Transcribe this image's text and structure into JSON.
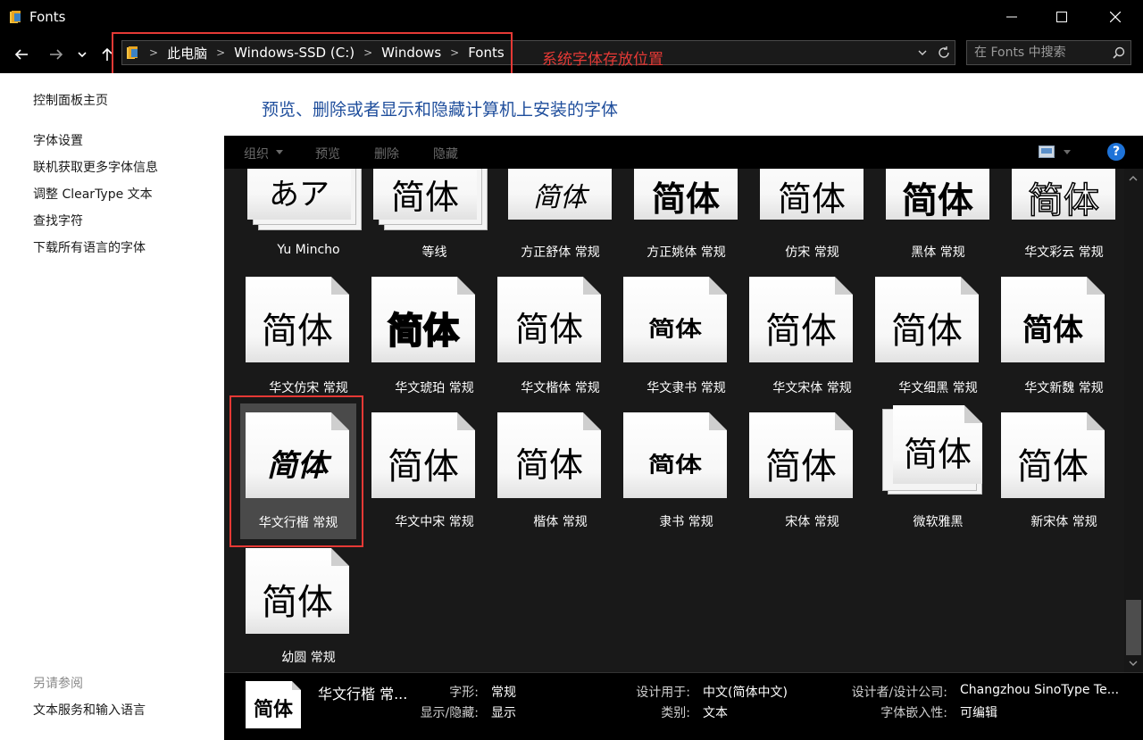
{
  "window": {
    "title": "Fonts"
  },
  "nav": {
    "breadcrumbs": [
      "此电脑",
      "Windows-SSD (C:)",
      "Windows",
      "Fonts"
    ],
    "search_placeholder": "在 Fonts 中搜索",
    "annotation": "系统字体存放位置"
  },
  "sidebar": {
    "links": [
      "控制面板主页",
      "字体设置",
      "联机获取更多字体信息",
      "调整 ClearType 文本",
      "查找字符",
      "下载所有语言的字体"
    ],
    "see_also_title": "另请参阅",
    "see_also_links": [
      "文本服务和输入语言"
    ]
  },
  "main": {
    "heading": "预览、删除或者显示和隐藏计算机上安装的字体",
    "commands": [
      "组织",
      "预览",
      "删除",
      "隐藏"
    ],
    "help": "?"
  },
  "fonts": [
    {
      "sample": "あア",
      "label": "Yu Mincho"
    },
    {
      "sample": "简体",
      "label": "等线"
    },
    {
      "sample": "简体",
      "label": "方正舒体 常规"
    },
    {
      "sample": "简体",
      "label": "方正姚体 常规"
    },
    {
      "sample": "简体",
      "label": "仿宋 常规"
    },
    {
      "sample": "简体",
      "label": "黑体 常规"
    },
    {
      "sample": "简体",
      "label": "华文彩云 常规"
    },
    {
      "sample": "简体",
      "label": "华文仿宋 常规"
    },
    {
      "sample": "简体",
      "label": "华文琥珀 常规"
    },
    {
      "sample": "简体",
      "label": "华文楷体 常规"
    },
    {
      "sample": "简体",
      "label": "华文隶书 常规"
    },
    {
      "sample": "简体",
      "label": "华文宋体 常规"
    },
    {
      "sample": "简体",
      "label": "华文细黑 常规"
    },
    {
      "sample": "简体",
      "label": "华文新魏 常规"
    },
    {
      "sample": "简体",
      "label": "华文行楷 常规"
    },
    {
      "sample": "简体",
      "label": "华文中宋 常规"
    },
    {
      "sample": "简体",
      "label": "楷体 常规"
    },
    {
      "sample": "简体",
      "label": "隶书 常规"
    },
    {
      "sample": "简体",
      "label": "宋体 常规"
    },
    {
      "sample": "简体",
      "label": "微软雅黑"
    },
    {
      "sample": "简体",
      "label": "新宋体 常规"
    },
    {
      "sample": "简体",
      "label": "幼圆 常规"
    }
  ],
  "details": {
    "sample": "简体",
    "name": "华文行楷 常...",
    "style_key": "字形:",
    "style_val": "常规",
    "showhide_key": "显示/隐藏:",
    "showhide_val": "显示",
    "designed_key": "设计用于:",
    "designed_val": "中文(简体中文)",
    "category_key": "类别:",
    "category_val": "文本",
    "designer_key": "设计者/设计公司:",
    "designer_val": "Changzhou SinoType Te...",
    "embed_key": "字体嵌入性:",
    "embed_val": "可编辑"
  }
}
